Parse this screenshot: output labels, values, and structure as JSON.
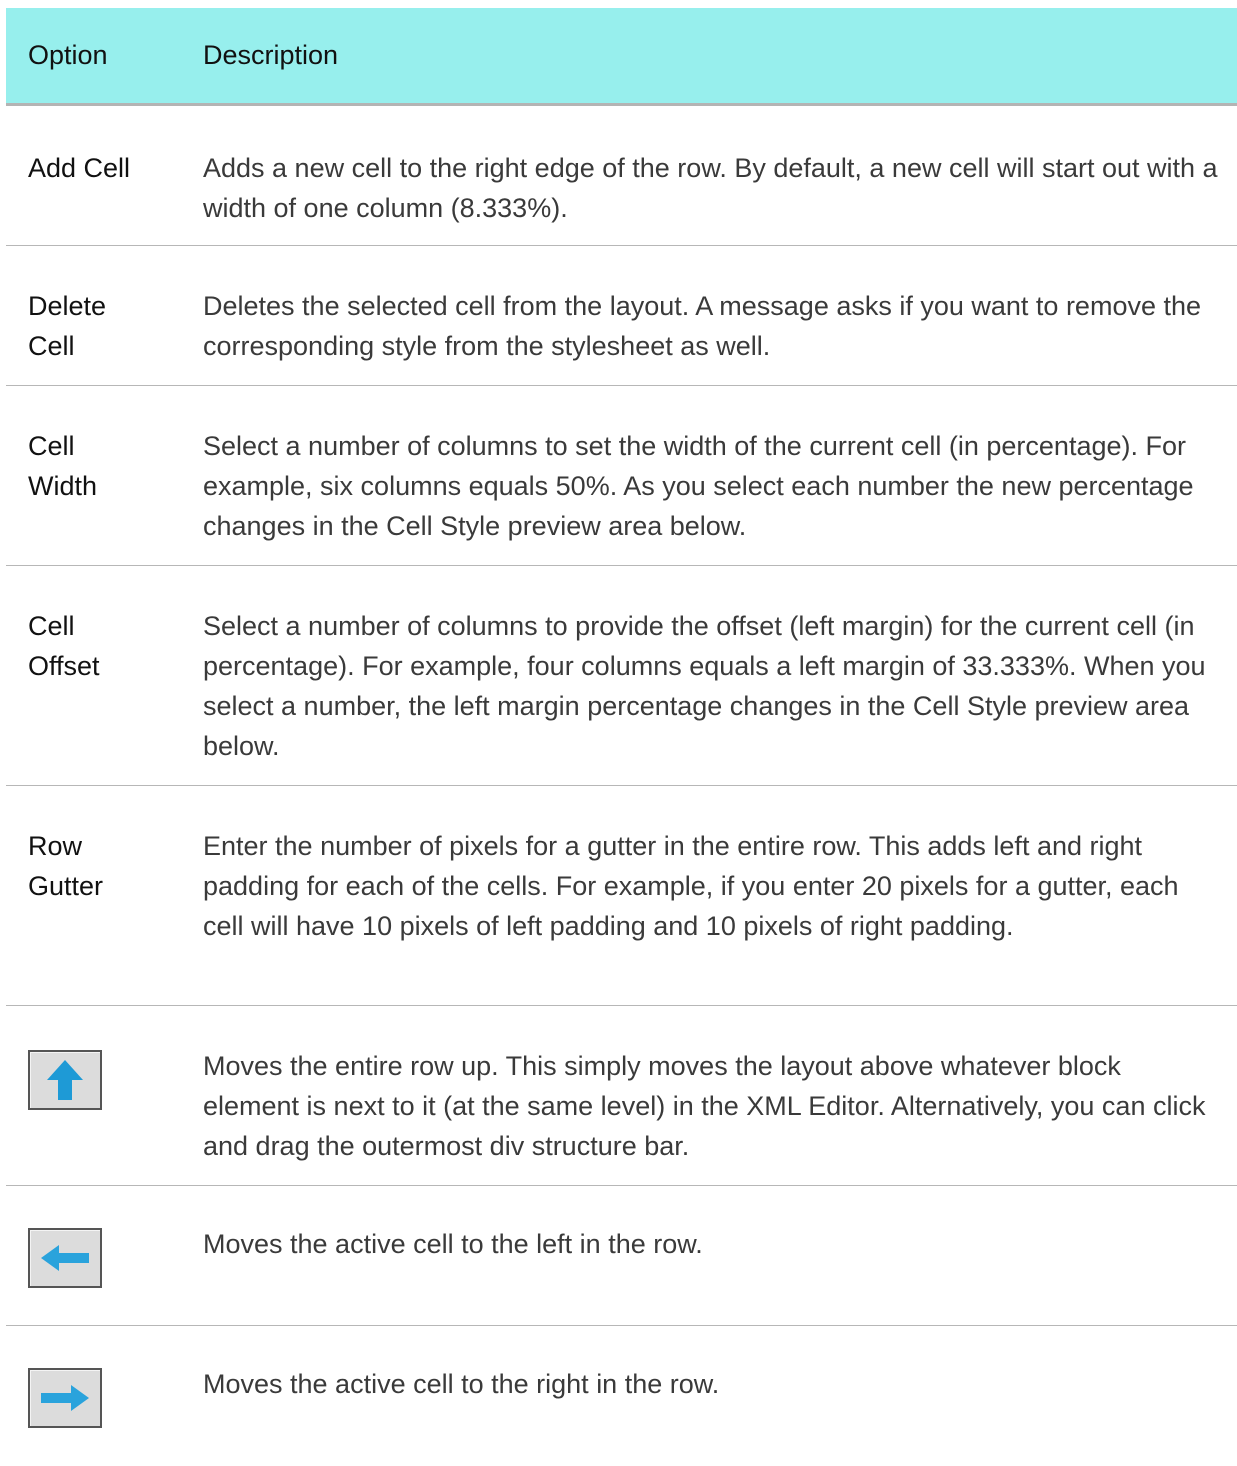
{
  "header": {
    "option": "Option",
    "description": "Description"
  },
  "rows": [
    {
      "option": "Add Cell",
      "description": "Adds a new cell to the right edge of the row. By default, a new cell will start out with a width of one column (8.333%)."
    },
    {
      "option": "Delete Cell",
      "description": "Deletes the selected cell from the layout. A message asks if you want to remove the corresponding style from the stylesheet as well."
    },
    {
      "option": "Cell Width",
      "description": "Select a number of columns to set the width of the current cell (in percentage). For example, six columns equals 50%. As you select each number the new percentage changes in the Cell Style preview area below."
    },
    {
      "option": "Cell Offset",
      "description": "Select a number of columns to provide the offset (left margin) for the current cell (in percentage). For example, four columns equals a left margin of 33.333%. When you select a number, the left margin percentage changes in the Cell Style preview area below."
    },
    {
      "option": "Row Gutter",
      "description": "Enter the number of pixels for a gutter in the entire row. This adds left and right padding for each of the cells. For example, if you enter 20 pixels for a gutter, each cell will have 10 pixels of left padding and 10 pixels of right padding."
    },
    {
      "icon": "arrow-up-icon",
      "description": "Moves the entire row up. This simply moves the layout above whatever block element is next to it (at the same level) in the XML Editor. Alternatively, you can click and drag the outermost div structure bar."
    },
    {
      "icon": "arrow-left-icon",
      "description": "Moves the active cell to the left in the row."
    },
    {
      "icon": "arrow-right-icon",
      "description": "Moves the active cell to the right in the row."
    }
  ],
  "colors": {
    "header_bg": "#97efed",
    "arrow": "#1e9ad6"
  }
}
